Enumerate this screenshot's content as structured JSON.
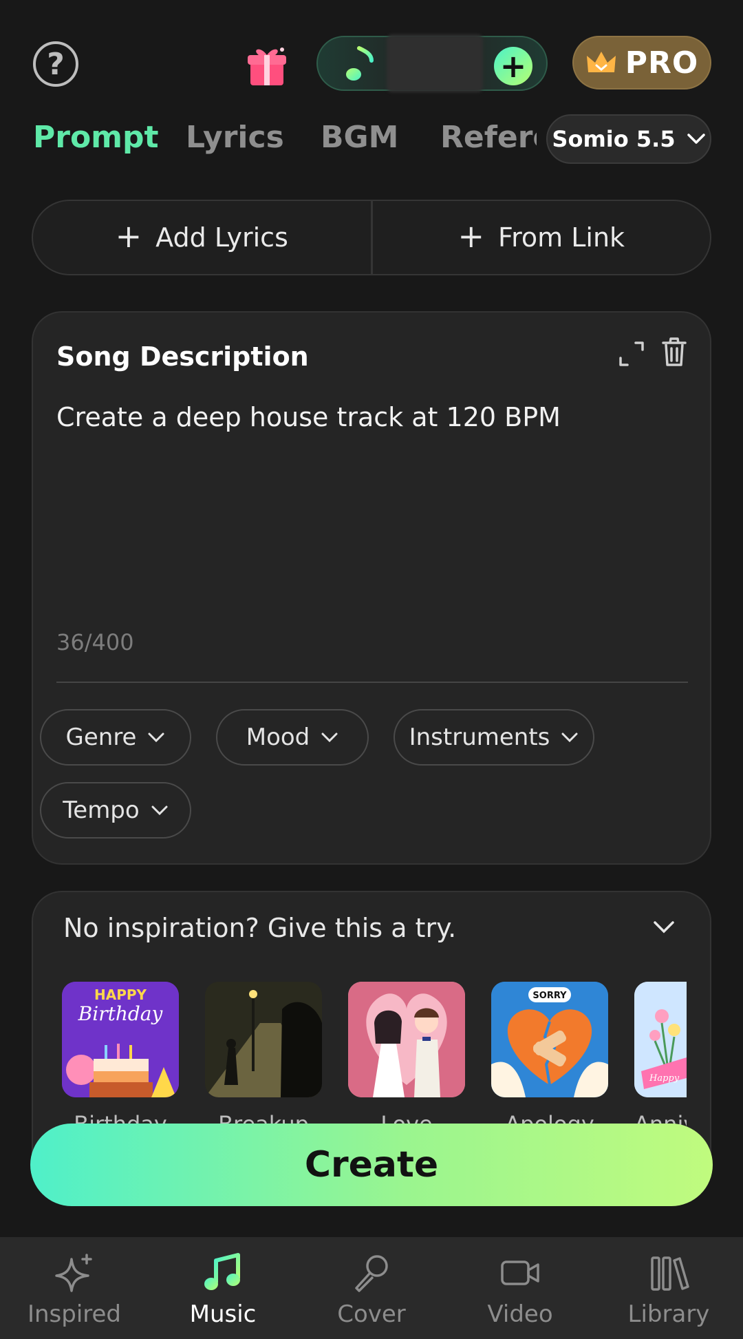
{
  "header": {
    "help_icon": "question-circle-icon",
    "gift_icon": "gift-icon",
    "credits_icon": "music-note-icon",
    "add_credits_icon": "plus-icon",
    "pro_label": "PRO",
    "pro_icon": "crown-icon"
  },
  "tabs": [
    {
      "label": "Prompt",
      "active": true
    },
    {
      "label": "Lyrics",
      "active": false
    },
    {
      "label": "BGM",
      "active": false
    },
    {
      "label": "Reference",
      "active": false
    }
  ],
  "model": {
    "label": "Somio 5.5"
  },
  "actions": {
    "add_lyrics": "Add Lyrics",
    "from_link": "From Link"
  },
  "description_card": {
    "title": "Song Description",
    "text": "Create a deep house track at 120 BPM",
    "counter": "36/400",
    "chips": [
      "Genre",
      "Mood",
      "Instruments",
      "Tempo"
    ]
  },
  "inspiration": {
    "title": "No inspiration? Give this a try.",
    "items": [
      {
        "label": "Birthday",
        "thumb_text_1": "HAPPY",
        "thumb_text_2": "Birthday"
      },
      {
        "label": "Breakup"
      },
      {
        "label": "Love"
      },
      {
        "label": "Apology",
        "thumb_text_1": "SORRY"
      },
      {
        "label": "Anniversary",
        "thumb_text_1": "Happy"
      }
    ]
  },
  "create_label": "Create",
  "nav": [
    {
      "label": "Inspired",
      "icon": "sparkle-icon",
      "active": false
    },
    {
      "label": "Music",
      "icon": "music-note-icon",
      "active": true
    },
    {
      "label": "Cover",
      "icon": "microphone-icon",
      "active": false
    },
    {
      "label": "Video",
      "icon": "video-camera-icon",
      "active": false
    },
    {
      "label": "Library",
      "icon": "library-icon",
      "active": false
    }
  ],
  "colors": {
    "accent_green": "#5fe9a8",
    "pro_gold": "#7a6238",
    "background": "#181818",
    "card": "#252525"
  }
}
